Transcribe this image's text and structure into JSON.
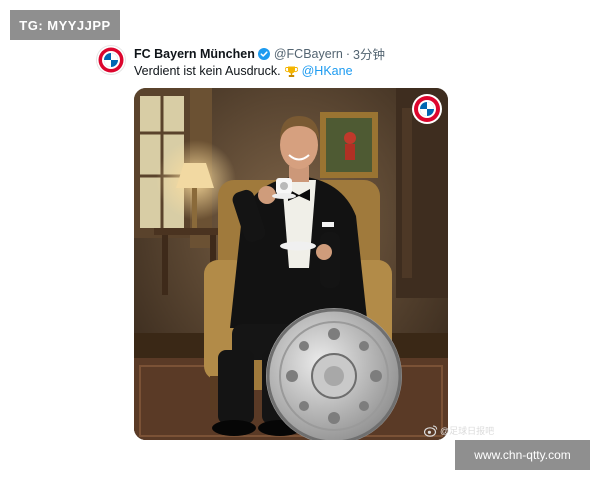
{
  "watermarks": {
    "top_left": "TG: MYYJJPP",
    "bottom_right": "www.chn-qtty.com",
    "weibo": "@足球日报吧"
  },
  "tweet": {
    "account_name": "FC Bayern München",
    "handle": "@FCBayern",
    "separator": "·",
    "time": "3分钟",
    "text": "Verdient ist kein Ausdruck.",
    "mention": "@HKane",
    "icons": [
      "fc-bayern-logo-icon",
      "verified-badge-icon",
      "trophy-emoji-icon"
    ]
  },
  "colors": {
    "verified": "#1d9bf0",
    "mention": "#1d9bf0",
    "bayern_red": "#dc052d",
    "bayern_blue": "#0066b2",
    "watermark_bg": "#8f8f8f"
  }
}
